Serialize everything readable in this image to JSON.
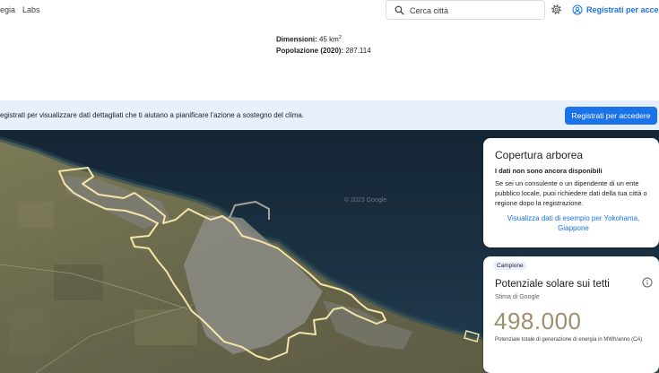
{
  "nav": {
    "item1": "egia",
    "item2": "Labs",
    "search_placeholder": "Cerca città",
    "signin_label": "Registrati per accedere"
  },
  "stats": {
    "area_label": "Dimensioni:",
    "area_value": "45 km",
    "area_sup": "2",
    "population_label": "Popolazione (2020):",
    "population_value": "287.114"
  },
  "banner": {
    "text": "egistrati per visualizzare dati dettagliati che ti aiutano a pianificare l'azione a sostegno del clima.",
    "button_label": "Registrati per accedere"
  },
  "map": {
    "watermark": "© 2023 Google"
  },
  "tree_card": {
    "title": "Copertura arborea",
    "subtitle": "I dati non sono ancora disponibili",
    "body": "Se sei un consulente o un dipendente di un ente pubblico locale, puoi richiedere dati della tua città o regione dopo la registrazione.",
    "link": "Visualizza dati di esempio per Yokohama, Giappone"
  },
  "solar_card": {
    "badge": "Campione",
    "title": "Potenziale solare sui tetti",
    "subtitle": "Stima di Google",
    "value": "498.000",
    "caption": "Potenziale totale di generazione di energia in MWh/anno (CA)"
  },
  "colors": {
    "accent": "#1a73e8",
    "banner_bg": "#e8f0fe",
    "sea": "#1e3648",
    "land": "#6b6a4c",
    "boundary": "#f3e4a8",
    "solar_value": "#a08e6c"
  },
  "icons": [
    "search-icon",
    "gear-icon",
    "account-circle-icon",
    "info-icon"
  ]
}
